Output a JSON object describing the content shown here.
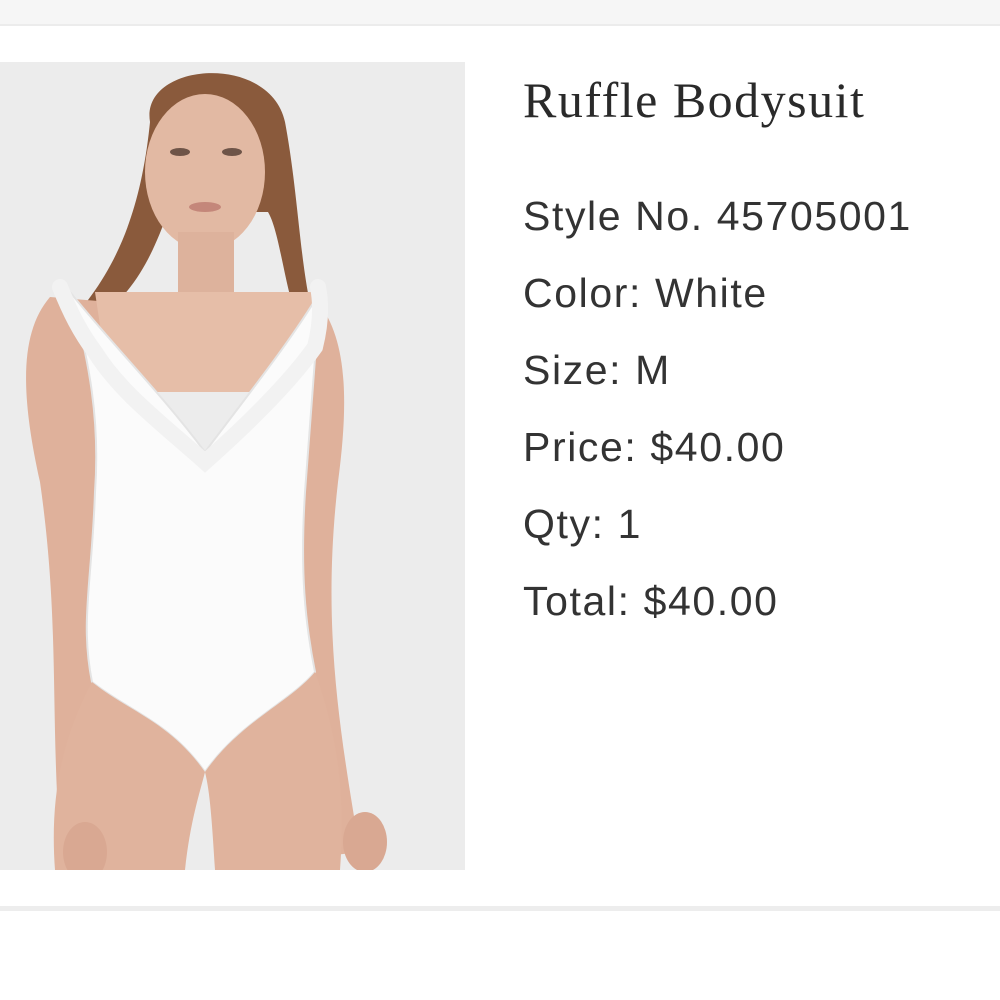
{
  "product": {
    "title": "Ruffle Bodysuit",
    "style": "Style No. 45705001",
    "color": "Color: White",
    "size": "Size: M",
    "price": "Price: $40.00",
    "qty": "Qty: 1",
    "total": "Total: $40.00"
  },
  "colors": {
    "text": "#2a2a2a",
    "image_background": "#ededed",
    "divider": "#ededed"
  }
}
